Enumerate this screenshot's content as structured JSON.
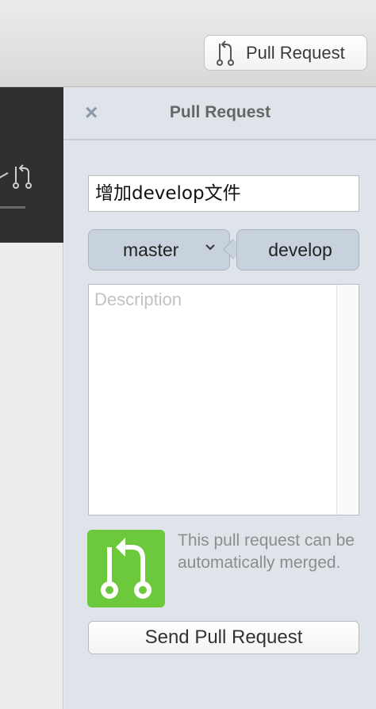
{
  "toolbar": {
    "pull_request_button": {
      "label": "Pull Request",
      "icon": "pull-request-icon"
    }
  },
  "panel": {
    "title": "Pull Request",
    "close_symbol": "×",
    "title_field": {
      "value": "增加develop文件"
    },
    "target_branch": {
      "label": "master",
      "icon": "chevron-down-icon"
    },
    "source_branch": {
      "label": "develop"
    },
    "description": {
      "placeholder": "Description",
      "value": ""
    },
    "merge_status": {
      "message": "This pull request can be automatically merged.",
      "icon": "merge-icon",
      "color": "#6cc93c"
    },
    "send_button": {
      "label": "Send Pull Request"
    }
  },
  "colors": {
    "panel_bg": "#dfe4ea",
    "branch_bg": "#c8d2dc",
    "dark_sidebar": "#2f2f2f"
  }
}
